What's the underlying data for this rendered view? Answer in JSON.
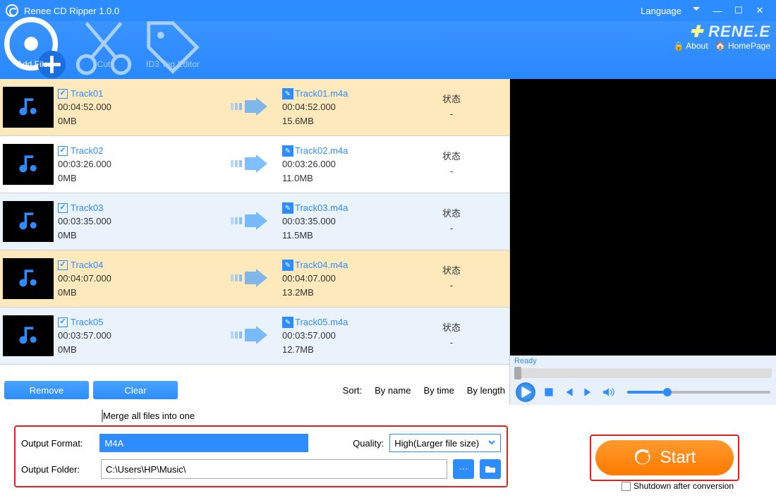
{
  "title": "Renee CD Ripper 1.0.0",
  "language_label": "Language",
  "brand": "RENE.E",
  "brand_about": "About",
  "brand_home": "HomePage",
  "toolbar": {
    "add_files": "Add Files",
    "cut": "Cut",
    "id3": "ID3 Tag Editor"
  },
  "tracks": [
    {
      "name": "Track01",
      "dur": "00:04:52.000",
      "size": "0MB",
      "out": "Track01.m4a",
      "odur": "00:04:52.000",
      "osize": "15.6MB",
      "status": "状态",
      "val": "-",
      "sel": true
    },
    {
      "name": "Track02",
      "dur": "00:03:26.000",
      "size": "0MB",
      "out": "Track02.m4a",
      "odur": "00:03:26.000",
      "osize": "11.0MB",
      "status": "状态",
      "val": "-",
      "sel": false
    },
    {
      "name": "Track03",
      "dur": "00:03:35.000",
      "size": "0MB",
      "out": "Track03.m4a",
      "odur": "00:03:35.000",
      "osize": "11.5MB",
      "status": "状态",
      "val": "-",
      "sel": false
    },
    {
      "name": "Track04",
      "dur": "00:04:07.000",
      "size": "0MB",
      "out": "Track04.m4a",
      "odur": "00:04:07.000",
      "osize": "13.2MB",
      "status": "状态",
      "val": "-",
      "sel": true
    },
    {
      "name": "Track05",
      "dur": "00:03:57.000",
      "size": "0MB",
      "out": "Track05.m4a",
      "odur": "00:03:57.000",
      "osize": "12.7MB",
      "status": "状态",
      "val": "-",
      "sel": false
    }
  ],
  "buttons": {
    "remove": "Remove",
    "clear": "Clear"
  },
  "sort": {
    "label": "Sort:",
    "byname": "By name",
    "bytime": "By time",
    "bylength": "By length"
  },
  "player": {
    "ready": "Ready"
  },
  "merge_label": "Merge all files into one",
  "output_format_label": "Output Format:",
  "output_format_value": "M4A",
  "quality_label": "Quality:",
  "quality_value": "High(Larger file size)",
  "output_folder_label": "Output Folder:",
  "output_folder_value": "C:\\Users\\HP\\Music\\",
  "start_label": "Start",
  "shutdown_label": "Shutdown after conversion"
}
